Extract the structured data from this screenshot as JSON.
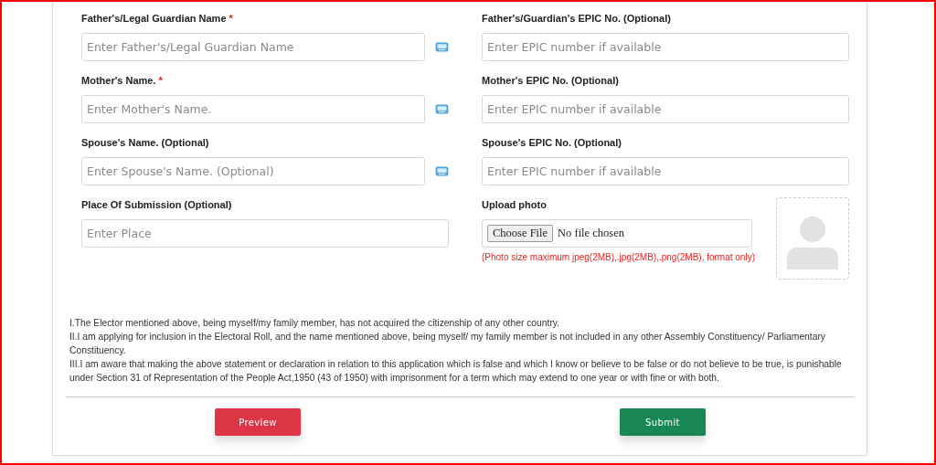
{
  "rows": [
    {
      "cells": [
        {
          "kind": "text",
          "label": "Father's/Legal Guardian Name",
          "mark": "*",
          "placeholder": "Enter Father's/Legal Guardian Name",
          "keyboard": true
        },
        {
          "kind": "text",
          "label": "Father's/Guardian's EPIC No. (Optional)",
          "placeholder": "Enter EPIC number if available",
          "keyboard": false
        }
      ]
    },
    {
      "cells": [
        {
          "kind": "text",
          "label": "Mother's Name.",
          "mark": "*",
          "placeholder": "Enter Mother's Name.",
          "keyboard": true
        },
        {
          "kind": "text",
          "label": "Mother's EPIC No. (Optional)",
          "placeholder": "Enter EPIC number if available",
          "keyboard": false
        }
      ]
    },
    {
      "cells": [
        {
          "kind": "text",
          "label": "Spouse's Name. (Optional)",
          "placeholder": "Enter Spouse's Name. (Optional)",
          "keyboard": true
        },
        {
          "kind": "text",
          "label": "Spouse's EPIC No. (Optional)",
          "placeholder": "Enter EPIC number if available",
          "keyboard": false
        }
      ]
    },
    {
      "cells": [
        {
          "kind": "text",
          "label": "Place Of Submission (Optional)",
          "placeholder": "Enter Place",
          "keyboard": false
        },
        {
          "kind": "upload",
          "label": "Upload photo",
          "button": "Choose File",
          "status": "No file chosen",
          "hint": "(Photo size maximum jpeg(2MB),.jpg(2MB),.png(2MB), format only)"
        }
      ]
    }
  ],
  "declarations": [
    "I.The Elector mentioned above, being myself/my family member, has not acquired the citizenship of any other country.",
    "II.I am applying for inclusion in the Electoral Roll, and the name mentioned above, being myself/ my family member is not included in any other Assembly Constituency/ Parliamentary Constituency.",
    "III.I am aware that making the above statement or declaration in relation to this application which is false and which I know or believe to be false or do not believe to be true, is punishable under Section 31 of Representation of the People Act,1950 (43 of 1950) with imprisonment for a term which may extend to one year or with fine or with both."
  ],
  "buttons": [
    {
      "kind": "preview",
      "label": "Preview"
    },
    {
      "kind": "submit",
      "label": "Submit"
    }
  ]
}
